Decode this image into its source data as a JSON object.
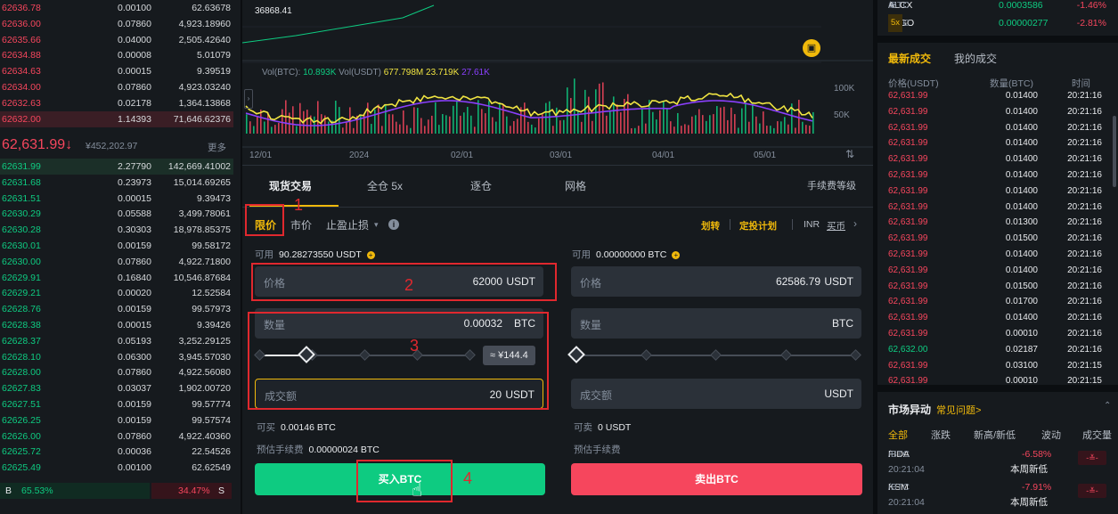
{
  "orderbook": {
    "asks": [
      {
        "price": "62636.78",
        "amount": "0.00100",
        "total": "62.63678"
      },
      {
        "price": "62636.00",
        "amount": "0.07860",
        "total": "4,923.18960"
      },
      {
        "price": "62635.66",
        "amount": "0.04000",
        "total": "2,505.42640"
      },
      {
        "price": "62634.88",
        "amount": "0.00008",
        "total": "5.01079"
      },
      {
        "price": "62634.63",
        "amount": "0.00015",
        "total": "9.39519"
      },
      {
        "price": "62634.00",
        "amount": "0.07860",
        "total": "4,923.03240"
      },
      {
        "price": "62632.63",
        "amount": "0.02178",
        "total": "1,364.13868"
      },
      {
        "price": "62632.00",
        "amount": "1.14393",
        "total": "71,646.62376"
      }
    ],
    "last_price": "62,631.99",
    "last_arrow": "↓",
    "last_cny": "¥452,202.97",
    "more_label": "更多",
    "bids": [
      {
        "price": "62631.99",
        "amount": "2.27790",
        "total": "142,669.41002"
      },
      {
        "price": "62631.68",
        "amount": "0.23973",
        "total": "15,014.69265"
      },
      {
        "price": "62631.51",
        "amount": "0.00015",
        "total": "9.39473"
      },
      {
        "price": "62630.29",
        "amount": "0.05588",
        "total": "3,499.78061"
      },
      {
        "price": "62630.28",
        "amount": "0.30303",
        "total": "18,978.85375"
      },
      {
        "price": "62630.01",
        "amount": "0.00159",
        "total": "99.58172"
      },
      {
        "price": "62630.00",
        "amount": "0.07860",
        "total": "4,922.71800"
      },
      {
        "price": "62629.91",
        "amount": "0.16840",
        "total": "10,546.87684"
      },
      {
        "price": "62629.21",
        "amount": "0.00020",
        "total": "12.52584"
      },
      {
        "price": "62628.76",
        "amount": "0.00159",
        "total": "99.57973"
      },
      {
        "price": "62628.38",
        "amount": "0.00015",
        "total": "9.39426"
      },
      {
        "price": "62628.37",
        "amount": "0.05193",
        "total": "3,252.29125"
      },
      {
        "price": "62628.10",
        "amount": "0.06300",
        "total": "3,945.57030"
      },
      {
        "price": "62628.00",
        "amount": "0.07860",
        "total": "4,922.56080"
      },
      {
        "price": "62627.83",
        "amount": "0.03037",
        "total": "1,902.00720"
      },
      {
        "price": "62627.51",
        "amount": "0.00159",
        "total": "99.57774"
      },
      {
        "price": "62626.25",
        "amount": "0.00159",
        "total": "99.57574"
      },
      {
        "price": "62626.00",
        "amount": "0.07860",
        "total": "4,922.40360"
      },
      {
        "price": "62625.72",
        "amount": "0.00036",
        "total": "22.54526"
      },
      {
        "price": "62625.49",
        "amount": "0.00100",
        "total": "62.62549"
      }
    ],
    "buy_label": "B",
    "buy_ratio": "65.53%",
    "sell_ratio": "34.47%",
    "sell_label": "S"
  },
  "chart": {
    "price_label": "36868.41",
    "vol_title": "Vol(BTC):",
    "vol_btc": "10.893K",
    "vol_usdt_title": "Vol(USDT)",
    "vol_usdt": "677.798M",
    "ma1": "23.719K",
    "ma2": "27.61K",
    "y_ticks": [
      "100K",
      "50K"
    ],
    "x_ticks": [
      "12/01",
      "2024",
      "02/01",
      "03/01",
      "04/01",
      "05/01"
    ],
    "colors": {
      "up": "#0ecb81",
      "down": "#f6465d",
      "ma_yellow": "#f0e442",
      "ma_purple": "#8a3ffc"
    }
  },
  "trade": {
    "tabs": [
      "现货交易",
      "全仓 5x",
      "逐仓",
      "网格"
    ],
    "fee_label": "手续费等级",
    "order_types": [
      "限价",
      "市价",
      "止盈止损"
    ],
    "links": {
      "transfer": "划转",
      "dca": "定投计划",
      "inr": "INR",
      "buy": "买币"
    },
    "buy": {
      "available_label": "可用",
      "available_value": "90.28273550 USDT",
      "price_label": "价格",
      "price_value": "62000",
      "price_unit": "USDT",
      "amount_label": "数量",
      "amount_value": "0.00032",
      "amount_unit": "BTC",
      "slider_percent": 22,
      "tooltip": "≈ ¥144.4",
      "total_label": "成交额",
      "total_value": "20",
      "total_unit": "USDT",
      "max_label": "可买",
      "max_value": "0.00146 BTC",
      "fee_label": "预估手续费",
      "fee_value": "0.00000024 BTC",
      "button": "买入BTC"
    },
    "sell": {
      "available_label": "可用",
      "available_value": "0.00000000 BTC",
      "price_label": "价格",
      "price_value": "62586.79",
      "price_unit": "USDT",
      "amount_label": "数量",
      "amount_unit": "BTC",
      "slider_percent": 0,
      "total_label": "成交额",
      "total_unit": "USDT",
      "max_label": "可卖",
      "max_value": "0 USDT",
      "fee_label": "预估手续费",
      "button": "卖出BTC"
    },
    "annotations": [
      "1",
      "2",
      "3",
      "4"
    ]
  },
  "markets": [
    {
      "pair": "ALCX",
      "quote": "/BTC",
      "price": "0.0003586",
      "change": "-1.46%"
    },
    {
      "pair": "ALGO",
      "quote": "/BTC",
      "lev": "5x",
      "price": "0.00000277",
      "change": "-2.81%"
    }
  ],
  "trades": {
    "tabs": [
      "最新成交",
      "我的成交"
    ],
    "headers": [
      "价格(USDT)",
      "数量(BTC)",
      "时间"
    ],
    "rows": [
      {
        "price": "62,631.99",
        "qty": "0.01400",
        "time": "20:21:16",
        "side": "sell"
      },
      {
        "price": "62,631.99",
        "qty": "0.01400",
        "time": "20:21:16",
        "side": "sell"
      },
      {
        "price": "62,631.99",
        "qty": "0.01400",
        "time": "20:21:16",
        "side": "sell"
      },
      {
        "price": "62,631.99",
        "qty": "0.01400",
        "time": "20:21:16",
        "side": "sell"
      },
      {
        "price": "62,631.99",
        "qty": "0.01400",
        "time": "20:21:16",
        "side": "sell"
      },
      {
        "price": "62,631.99",
        "qty": "0.01400",
        "time": "20:21:16",
        "side": "sell"
      },
      {
        "price": "62,631.99",
        "qty": "0.01400",
        "time": "20:21:16",
        "side": "sell"
      },
      {
        "price": "62,631.99",
        "qty": "0.01400",
        "time": "20:21:16",
        "side": "sell"
      },
      {
        "price": "62,631.99",
        "qty": "0.01300",
        "time": "20:21:16",
        "side": "sell"
      },
      {
        "price": "62,631.99",
        "qty": "0.01500",
        "time": "20:21:16",
        "side": "sell"
      },
      {
        "price": "62,631.99",
        "qty": "0.01400",
        "time": "20:21:16",
        "side": "sell"
      },
      {
        "price": "62,631.99",
        "qty": "0.01400",
        "time": "20:21:16",
        "side": "sell"
      },
      {
        "price": "62,631.99",
        "qty": "0.01500",
        "time": "20:21:16",
        "side": "sell"
      },
      {
        "price": "62,631.99",
        "qty": "0.01700",
        "time": "20:21:16",
        "side": "sell"
      },
      {
        "price": "62,631.99",
        "qty": "0.01400",
        "time": "20:21:16",
        "side": "sell"
      },
      {
        "price": "62,631.99",
        "qty": "0.00010",
        "time": "20:21:16",
        "side": "sell"
      },
      {
        "price": "62,632.00",
        "qty": "0.02187",
        "time": "20:21:16",
        "side": "buy"
      },
      {
        "price": "62,631.99",
        "qty": "0.03100",
        "time": "20:21:15",
        "side": "sell"
      },
      {
        "price": "62,631.99",
        "qty": "0.00010",
        "time": "20:21:15",
        "side": "sell"
      }
    ]
  },
  "movers": {
    "title": "市场异动",
    "faq": "常见问题>",
    "tabs": [
      "全部",
      "涨跌",
      "新高/新低",
      "波动",
      "成交量"
    ],
    "rows": [
      {
        "pair": "FIDA",
        "quote": "/BTC",
        "change": "-6.58%",
        "time": "20:21:04",
        "note": "本周新低"
      },
      {
        "pair": "KSM",
        "quote": "/BTC",
        "change": "-7.91%",
        "time": "20:21:04",
        "note": "本周新低"
      }
    ]
  }
}
